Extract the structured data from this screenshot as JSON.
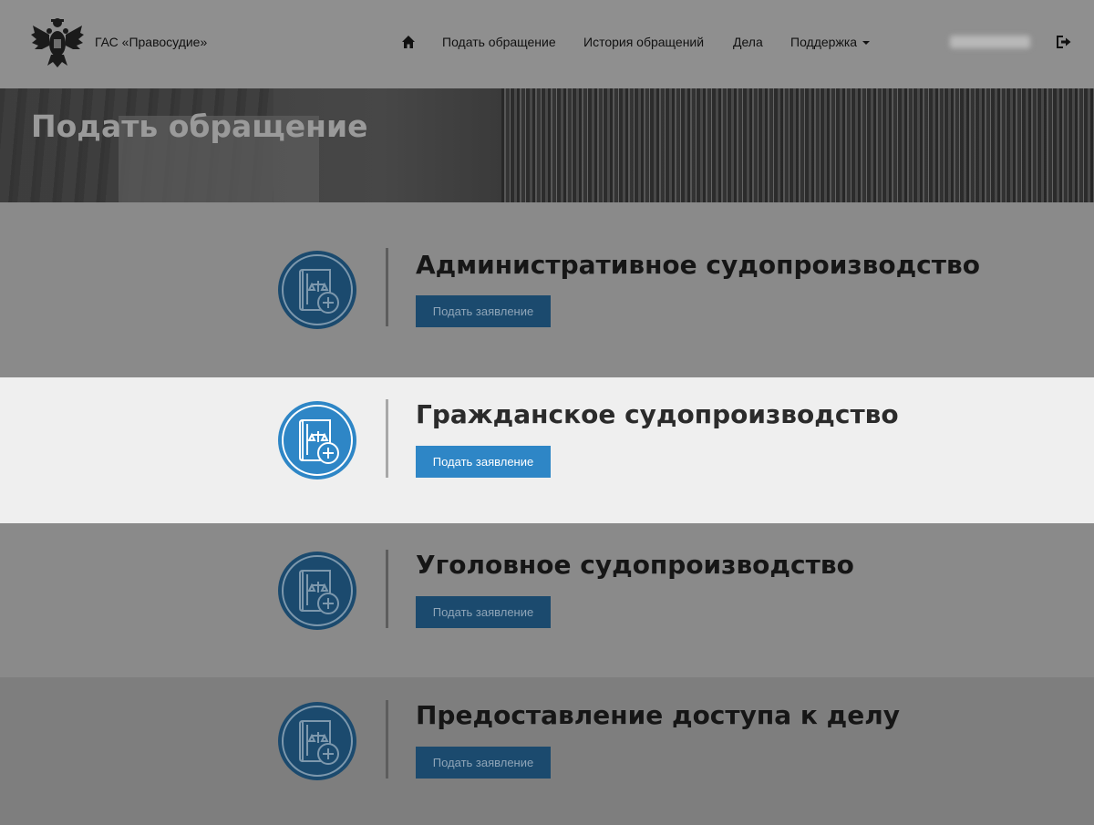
{
  "header": {
    "brand": "ГАС «Правосудие»",
    "nav": [
      {
        "label": "Подать обращение"
      },
      {
        "label": "История обращений"
      },
      {
        "label": "Дела"
      },
      {
        "label": "Поддержка"
      }
    ]
  },
  "banner": {
    "title": "Подать обращение"
  },
  "sections": [
    {
      "title": "Административное судопроизводство",
      "button": "Подать заявление"
    },
    {
      "title": "Гражданское судопроизводство",
      "button": "Подать заявление"
    },
    {
      "title": "Уголовное судопроизводство",
      "button": "Подать заявление"
    },
    {
      "title": "Предоставление доступа к делу",
      "button": "Подать заявление"
    }
  ],
  "icons": {
    "logo": "coat-of-arms-icon",
    "home": "home-icon",
    "logout": "logout-icon",
    "section": "law-book-plus-icon"
  },
  "colors": {
    "accent": "#2e86c6",
    "accent_dim": "#1b4a6e",
    "overlay": "#8a8a8a",
    "active_bg": "#efefef"
  }
}
